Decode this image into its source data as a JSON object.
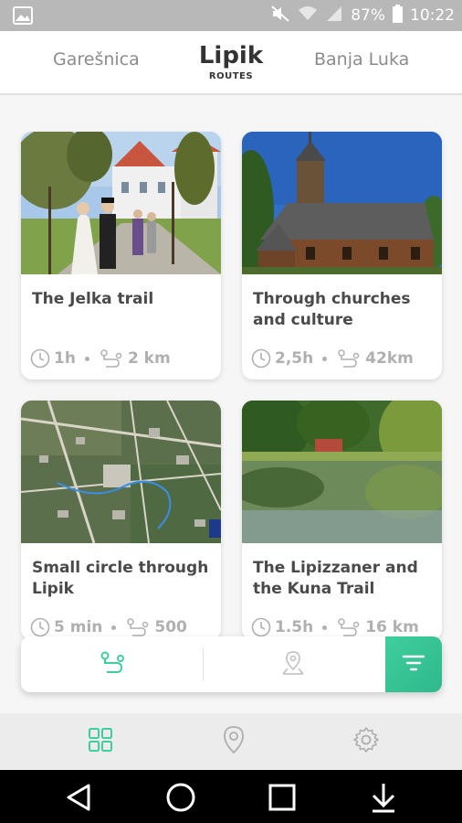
{
  "status_bar": {
    "battery": "87%",
    "time": "10:22"
  },
  "header": {
    "left_city": "Garešnica",
    "current_city": "Lipik",
    "current_subtitle": "ROUTES",
    "right_city": "Banja Luka"
  },
  "routes": [
    {
      "title": "The Jelka trail",
      "duration": "1h",
      "distance": "2 km"
    },
    {
      "title": "Through churches and culture",
      "duration": "2,5h",
      "distance": "42km"
    },
    {
      "title": "Small circle through Lipik",
      "duration": "5 min",
      "distance": "500"
    },
    {
      "title": "The Lipizzaner and the Kuna Trail",
      "duration": "1.5h",
      "distance": "16 km"
    }
  ],
  "colors": {
    "accent": "#3fcf9d",
    "text": "#4a4a4a",
    "meta": "#b0b0b0"
  },
  "icons": {
    "routes_tab": "route-icon",
    "map_tab": "map-pin-icon",
    "filter": "filter-icon",
    "nav_grid": "grid-icon",
    "nav_location": "location-icon",
    "nav_settings": "gear-icon"
  }
}
